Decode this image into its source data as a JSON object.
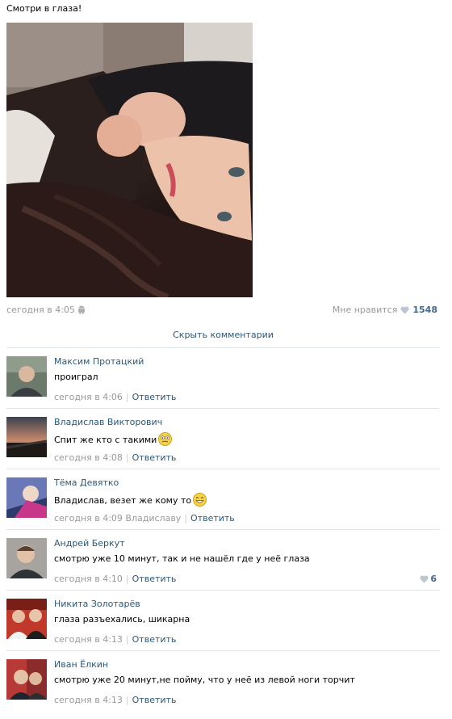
{
  "post": {
    "text": "Смотри в глаза!",
    "date": "сегодня в 4:05",
    "likes_label": "Мне нравится",
    "likes_count": "1548",
    "hide_comments": "Скрыть комментарии"
  },
  "icons": {
    "device": "android-icon",
    "like": "heart-icon",
    "smiley": "smiley-icon"
  },
  "colors": {
    "link": "#2b587a",
    "meta": "#999999",
    "like_count": "#45688e",
    "divider": "#e1e6eb"
  },
  "comments": [
    {
      "author": "Максим Протацкий",
      "text": "проиграл",
      "date": "сегодня в 4:06",
      "reply_to": "",
      "reply": "Ответить",
      "likes": ""
    },
    {
      "author": "Владислав Викторович",
      "text": "Спит же кто с такими",
      "date": "сегодня в 4:08",
      "reply_to": "",
      "reply": "Ответить",
      "likes": ""
    },
    {
      "author": "Тёма Девятко",
      "text": "Владислав, везет же кому то",
      "date": "сегодня в 4:09",
      "reply_to": "Владиславу",
      "reply": "Ответить",
      "likes": ""
    },
    {
      "author": "Андрей Беркут",
      "text": "смотрю уже 10 минут, так и не нашёл где у неё глаза",
      "date": "сегодня в 4:10",
      "reply_to": "",
      "reply": "Ответить",
      "likes": "6"
    },
    {
      "author": "Никита Золотарёв",
      "text": "глаза разъехались, шикарна",
      "date": "сегодня в 4:13",
      "reply_to": "",
      "reply": "Ответить",
      "likes": ""
    },
    {
      "author": "Иван Ёлкин",
      "text": "смотрю уже 20 минут,не пойму, что у неё из левой ноги торчит",
      "date": "сегодня в 4:13",
      "reply_to": "",
      "reply": "Ответить",
      "likes": ""
    }
  ]
}
